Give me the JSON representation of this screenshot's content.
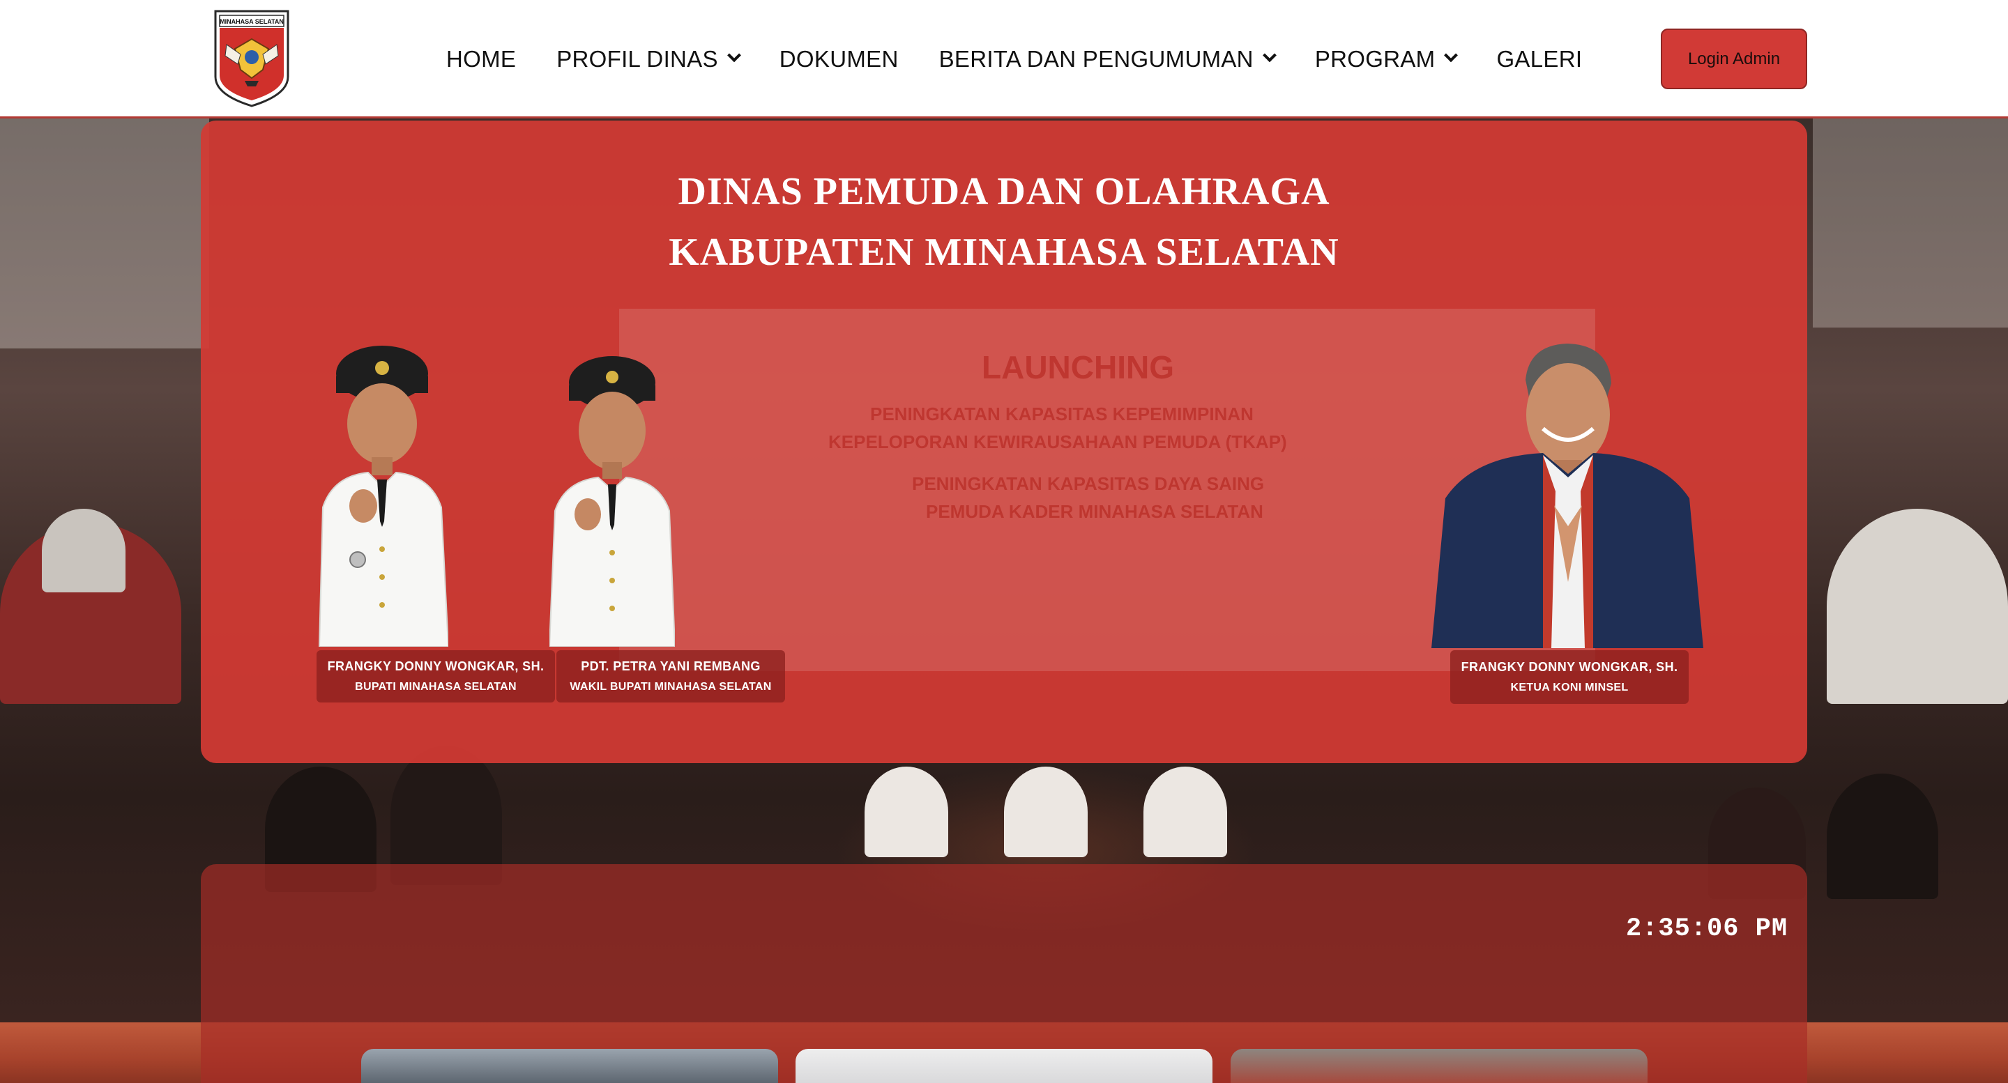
{
  "logo": {
    "text": "MINAHASA SELATAN",
    "icon": "regency-crest"
  },
  "nav": {
    "items": [
      {
        "label": "HOME",
        "has_dropdown": false
      },
      {
        "label": "PROFIL DINAS",
        "has_dropdown": true
      },
      {
        "label": "DOKUMEN",
        "has_dropdown": false
      },
      {
        "label": "BERITA DAN PENGUMUMAN",
        "has_dropdown": true
      },
      {
        "label": "PROGRAM",
        "has_dropdown": true
      },
      {
        "label": "GALERI",
        "has_dropdown": false
      }
    ],
    "login_label": "Login Admin"
  },
  "hero": {
    "title_line1": "DINAS PEMUDA DAN OLAHRAGA",
    "title_line2": "KABUPATEN MINAHASA SELATAN",
    "banner_text": {
      "line1": "LAUNCHING",
      "line2": "PENINGKATAN KAPASITAS KEPEMIMPINAN",
      "line3": "KEPELOPORAN KEWIRAUSAHAAN PEMUDA (TKAP)",
      "line4": "PENINGKATAN KAPASITAS DAYA SAING",
      "line5": "PEMUDA KADER MINAHASA SELATAN"
    },
    "officials": [
      {
        "name": "FRANGKY DONNY WONGKAR, SH.",
        "role": "BUPATI MINAHASA SELATAN"
      },
      {
        "name": "PDT. PETRA YANI REMBANG",
        "role": "WAKIL BUPATI MINAHASA SELATAN"
      },
      {
        "name": "FRANGKY DONNY WONGKAR, SH.",
        "role": "KETUA KONI MINSEL"
      }
    ]
  },
  "clock": {
    "time": "2:35:06 PM"
  },
  "colors": {
    "brand_red": "#d33a34",
    "dark_red": "#8c201e",
    "white": "#ffffff"
  }
}
